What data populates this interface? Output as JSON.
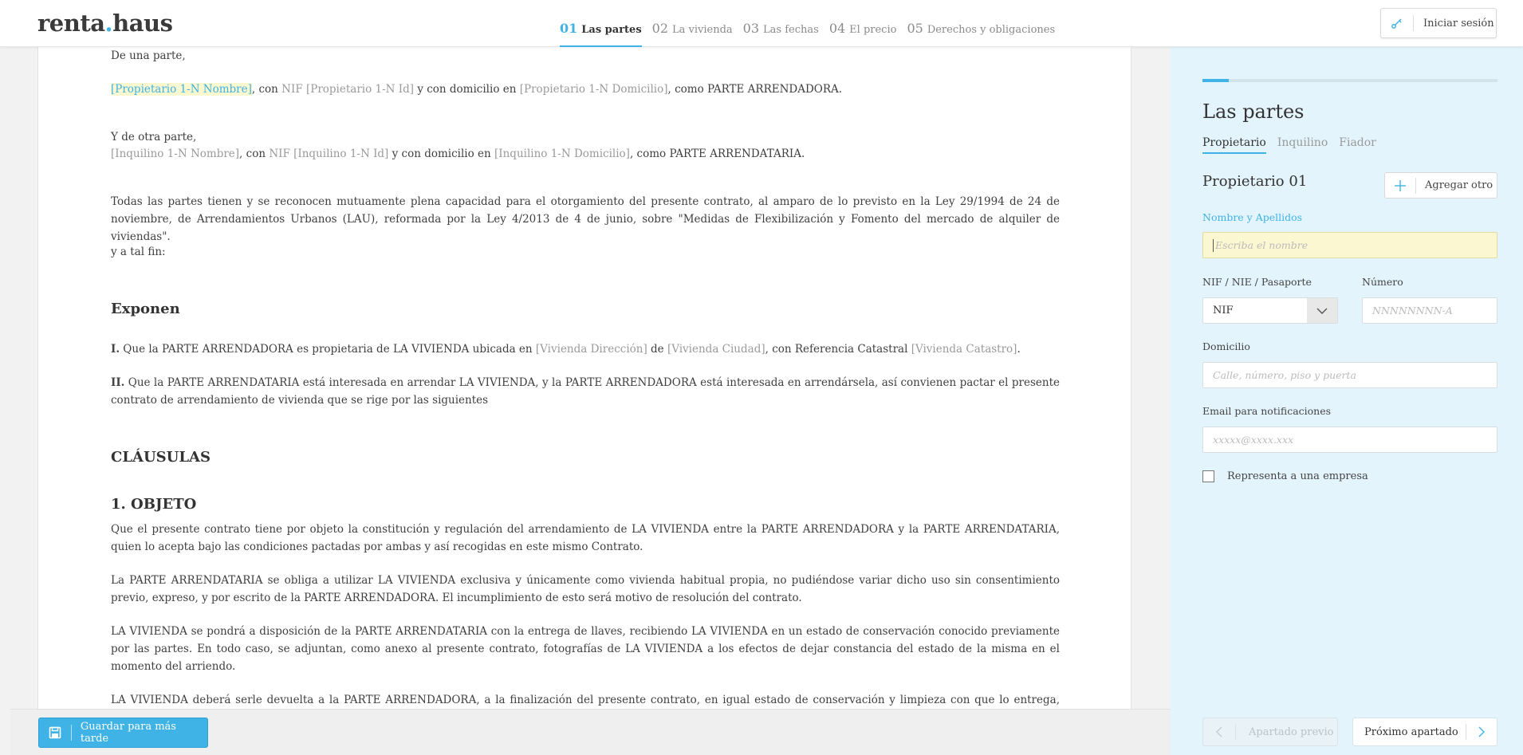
{
  "header": {
    "logo_text_1": "renta",
    "logo_dot": ".",
    "logo_text_2": "haus",
    "steps": [
      {
        "num": "01",
        "label": "Las partes"
      },
      {
        "num": "02",
        "label": "La vivienda"
      },
      {
        "num": "03",
        "label": "Las fechas"
      },
      {
        "num": "04",
        "label": "El precio"
      },
      {
        "num": "05",
        "label": "Derechos y obligaciones"
      }
    ],
    "login_label": "Iniciar sesión"
  },
  "document": {
    "intro": "De una parte,",
    "p1": {
      "owner_name": "[Propietario 1-N Nombre]",
      "t1": ", con ",
      "nif_label": "NIF",
      "owner_id": "[Propietario 1-N Id]",
      "t2": " y con domicilio en ",
      "owner_address": "[Propietario 1-N Domicilio]",
      "t3": ", como PARTE ARRENDADORA."
    },
    "other_part": "Y de otra parte,",
    "p2": {
      "tenant_name": "[Inquilino 1-N Nombre]",
      "t1": ", con ",
      "nif_label": "NIF",
      "tenant_id": "[Inquilino 1-N Id]",
      "t2": " y con domicilio en ",
      "tenant_address": "[Inquilino 1-N Domicilio]",
      "t3": ", como PARTE ARRENDATARIA."
    },
    "capacity": "Todas las partes tienen y se reconocen mutuamente plena capacidad para el otorgamiento del presente contrato, al amparo de lo previsto en la Ley 29/1994 de 24 de noviembre, de Arrendamientos Urbanos (LAU), reformada por la Ley 4/2013 de 4 de junio, sobre \"Medidas de Flexibilización y Fomento del mercado de alquiler de viviendas\".",
    "to_that_end": "y a tal fin:",
    "exponen_title": "Exponen",
    "exp1": {
      "num": "I.",
      "t1": " Que la PARTE ARRENDADORA es propietaria de LA VIVIENDA ubicada en ",
      "address": "[Vivienda Dirección]",
      "t2": " de ",
      "city": "[Vivienda Ciudad]",
      "t3": ", con Referencia Catastral ",
      "cadastre": "[Vivienda Catastro]",
      "t4": "."
    },
    "exp2": {
      "num": "II.",
      "text": " Que la PARTE ARRENDATARIA está interesada en arrendar LA VIVIENDA, y la PARTE ARRENDADORA está interesada en arrendársela, así convienen pactar el presente contrato de arrendamiento de vivienda que se rige por las siguientes"
    },
    "clausulas_title": "CLÁUSULAS",
    "objeto_title": "1. OBJETO",
    "obj1": "Que el presente contrato tiene por objeto la constitución y regulación del arrendamiento de LA VIVIENDA entre la PARTE ARRENDADORA y la PARTE ARRENDATARIA, quien lo acepta bajo las condiciones pactadas por ambas y así recogidas en este mismo Contrato.",
    "obj2": "La PARTE ARRENDATARIA se obliga a utilizar LA VIVIENDA exclusiva y únicamente como vivienda habitual propia, no pudiéndose variar dicho uso sin consentimiento previo, expreso, y por escrito de la PARTE ARRENDADORA. El incumplimiento de esto será motivo de resolución del contrato.",
    "obj3": "LA VIVIENDA se pondrá a disposición de la PARTE ARRENDATARIA con la entrega de llaves, recibiendo LA VIVIENDA en un estado de conservación conocido previamente por las partes. En todo caso, se adjuntan, como anexo al presente contrato, fotografías de LA VIVIENDA a los efectos de dejar constancia del estado de la misma en el momento del arriendo.",
    "obj4": "LA VIVIENDA deberá serle devuelta a la PARTE ARRENDADORA, a la finalización del presente contrato, en igual estado de conservación y limpieza con que lo entrega, salvo el"
  },
  "footer": {
    "save_label": "Guardar para más tarde"
  },
  "panel": {
    "progress_fraction": 0.09,
    "title": "Las partes",
    "subtabs": [
      "Propietario",
      "Inquilino",
      "Fiador"
    ],
    "owner_title": "Propietario 01",
    "add_label": "Agregar otro",
    "name_label": "Nombre y Apellidos",
    "name_placeholder": "Escriba el nombre",
    "doc_type_label": "NIF / NIE / Pasaporte",
    "doc_type_value": "NIF",
    "number_label": "Número",
    "number_placeholder": "NNNNNNNN-A",
    "address_label": "Domicilio",
    "address_placeholder": "Calle, número, piso y puerta",
    "email_label": "Email para notificaciones",
    "email_placeholder": "xxxxx@xxxx.xxx",
    "company_label": "Representa a una empresa",
    "prev_label": "Apartado previo",
    "next_label": "Próximo apartado"
  },
  "colors": {
    "accent": "#3fb3e6",
    "panel_bg": "#e3f4fc",
    "highlight": "#fbf7cf"
  }
}
